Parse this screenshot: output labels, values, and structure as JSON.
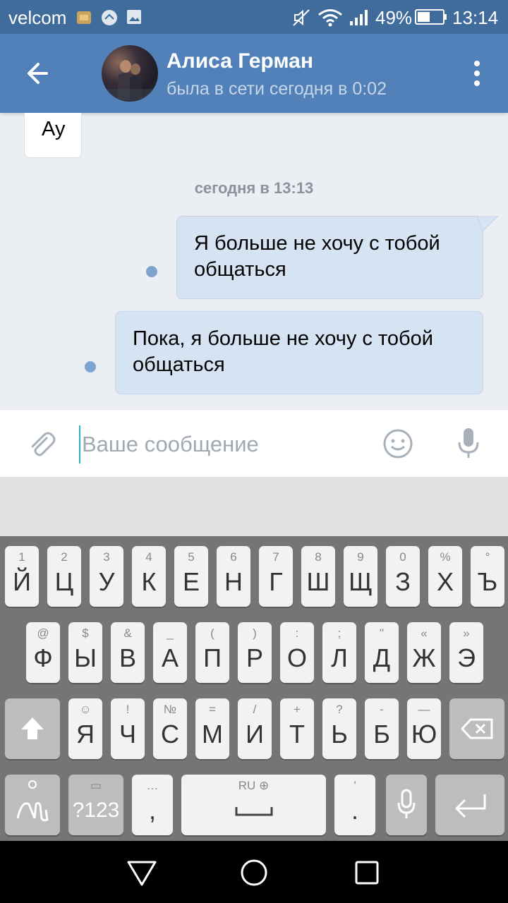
{
  "status_bar": {
    "carrier": "velcom",
    "battery": "49%",
    "time": "13:14",
    "icons": [
      "sim-icon",
      "usb-icon",
      "image-icon",
      "mute-icon",
      "wifi-icon",
      "signal-icon",
      "battery-icon"
    ]
  },
  "header": {
    "name": "Алиса Герман",
    "last_seen": "была в сети сегодня в 0:02",
    "icons": [
      "back-arrow-icon",
      "avatar",
      "more-vertical-icon"
    ]
  },
  "chat": {
    "incoming": [
      {
        "text": "Ау"
      }
    ],
    "date_separator": "сегодня в 13:13",
    "outgoing": [
      {
        "text": "Я больше не хочу с тобой общаться",
        "lines": [
          "Я больше не хочу с тобой",
          "общаться"
        ],
        "unread": true
      },
      {
        "text": "Пока, я больше не хочу с тобой общаться",
        "lines": [
          "Пока, я больше не хочу с тобой",
          "общаться"
        ],
        "unread": true
      }
    ]
  },
  "composer": {
    "placeholder": "Ваше сообщение",
    "value": "",
    "icons": [
      "paperclip-icon",
      "smiley-icon",
      "microphone-icon"
    ]
  },
  "keyboard": {
    "row1": [
      [
        "1",
        "Й"
      ],
      [
        "2",
        "Ц"
      ],
      [
        "3",
        "У"
      ],
      [
        "4",
        "К"
      ],
      [
        "5",
        "Е"
      ],
      [
        "6",
        "Н"
      ],
      [
        "7",
        "Г"
      ],
      [
        "8",
        "Ш"
      ],
      [
        "9",
        "Щ"
      ],
      [
        "0",
        "З"
      ],
      [
        "%",
        "Х"
      ],
      [
        "°",
        "Ъ"
      ]
    ],
    "row2": [
      [
        "@",
        "Ф"
      ],
      [
        "$",
        "Ы"
      ],
      [
        "&",
        "В"
      ],
      [
        "_",
        "А"
      ],
      [
        "(",
        "П"
      ],
      [
        ")",
        "Р"
      ],
      [
        ":",
        "О"
      ],
      [
        ";",
        "Л"
      ],
      [
        "\"",
        "Д"
      ],
      [
        "«",
        "Ж"
      ],
      [
        "»",
        "Э"
      ]
    ],
    "row3": [
      [
        "!",
        "Ч"
      ],
      [
        "№",
        "С"
      ],
      [
        "=",
        "М"
      ],
      [
        "/",
        "И"
      ],
      [
        "+",
        "Т"
      ],
      [
        "?",
        "Ь"
      ],
      [
        "-",
        "Б"
      ],
      [
        "—",
        "Ю"
      ]
    ],
    "row3_first": [
      "☺",
      "Я"
    ],
    "symbols_label": "?123",
    "comma_hint": "…",
    "comma": ",",
    "space_lang": "RU",
    "period_hint": "'",
    "period": ".",
    "icons": [
      "shift-icon",
      "backspace-icon",
      "swipe-gesture-icon",
      "microphone-icon",
      "enter-icon",
      "globe-icon"
    ]
  },
  "nav_bar": {
    "icons": [
      "back-triangle-icon",
      "home-circle-icon",
      "recents-square-icon"
    ]
  },
  "colors": {
    "header": "#5181b8",
    "status_bar": "#3f6c9b",
    "chat_bg": "#ebeef2",
    "outgoing_bubble": "#d6e3f3",
    "keyboard_bg": "#757575"
  }
}
